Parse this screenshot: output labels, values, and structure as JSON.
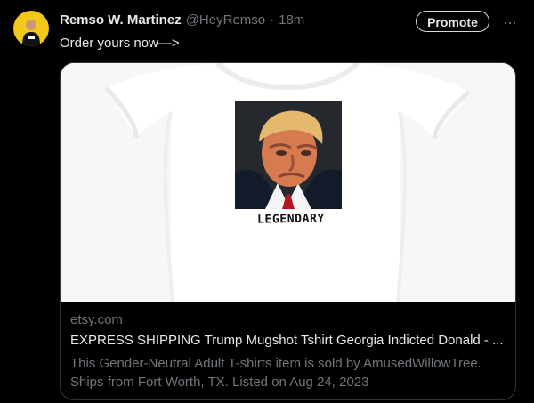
{
  "tweet": {
    "display_name": "Remso W. Martinez",
    "handle": "@HeyRemso",
    "separator": "·",
    "age": "18m",
    "text": "Order yours now—>"
  },
  "actions": {
    "promote_label": "Promote",
    "more_icon": "more-horizontal-icon",
    "more_label": "..."
  },
  "link_card": {
    "domain": "etsy.com",
    "title": "EXPRESS SHIPPING Trump Mugshot Tshirt Georgia Indicted Donald - ...",
    "description": "This Gender-Neutral Adult T-shirts item is sold by AmusedWillowTree. Ships from Fort Worth, TX. Listed on Aug 24, 2023",
    "shirt_caption": "LEGENDARY"
  },
  "colors": {
    "background": "#000000",
    "primary_text": "#e7e9ea",
    "secondary_text": "#71767b",
    "border": "#2f3336",
    "avatar_background": "#f3c81a"
  }
}
